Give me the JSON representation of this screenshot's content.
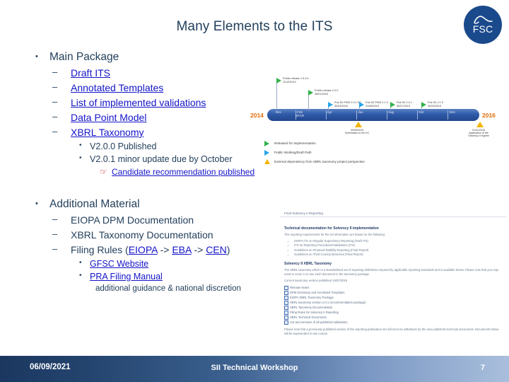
{
  "slide": {
    "title": "Many Elements to the ITS",
    "logo": {
      "text": "FSC",
      "icon": "fsc-mountain-logo",
      "color": "#1B4A8C"
    }
  },
  "content": {
    "main_package": {
      "label": "Main Package",
      "marker": "•",
      "items": [
        {
          "label": "Draft ITS",
          "marker": "–",
          "link": true
        },
        {
          "label": "Annotated Templates",
          "marker": "–",
          "link": true
        },
        {
          "label": "List of implemented validations",
          "marker": "–",
          "link": true
        },
        {
          "label": "Data Point Model",
          "marker": "–",
          "link": true
        },
        {
          "label": "XBRL Taxonomy",
          "marker": "–",
          "link": true
        }
      ],
      "taxonomy_notes": [
        {
          "label": "V2.0.0 Published",
          "marker": "•"
        },
        {
          "label": "V2.0.1 minor update due by October",
          "marker": "•"
        }
      ],
      "candidate_note": {
        "label": "Candidate recommendation published",
        "marker": "☞",
        "marker_color": "#C00000",
        "link": true
      }
    },
    "additional_material": {
      "label": "Additional Material",
      "marker": "•",
      "items": [
        {
          "label": "EIOPA DPM Documentation",
          "marker": "–",
          "link": false
        },
        {
          "label": "XBRL Taxonomy Documentation",
          "marker": "–",
          "link": false
        }
      ],
      "filing_rules": {
        "marker": "–",
        "prefix": "Filing Rules (",
        "link1": "EIOPA",
        "sep1": " -> ",
        "link2": "EBA",
        "sep2": " -> ",
        "link3": "CEN",
        "suffix": ")"
      },
      "sub_links": [
        {
          "label": "GFSC Website",
          "marker": "•",
          "link": true
        },
        {
          "label": "PRA Filing Manual",
          "marker": "•",
          "link": true
        }
      ],
      "note": "additional guidance & national discretion"
    }
  },
  "timeline": {
    "year_start": "2014",
    "year_end": "2016",
    "months": [
      "Dec",
      "Feb\nSFCR",
      "Apr",
      "Jun",
      "Aug",
      "Oct",
      "Dec"
    ],
    "milestones": [
      {
        "type": "green-flag",
        "title": "Public release 1.5.2.b",
        "date": "11/12/2014"
      },
      {
        "type": "green-flag",
        "title": "Public release 2.0.0",
        "date": "28/01/2015"
      },
      {
        "type": "blue-flag",
        "title": "Pub SII PWD 2.0.1 RC",
        "date": "30/04/2015"
      },
      {
        "type": "blue-flag",
        "title": "Pub SII PWD 2.1.0",
        "date": "31/08/2015"
      },
      {
        "type": "green-flag",
        "title": "Pub SII 2.0.1",
        "date": "30/07/2015"
      },
      {
        "type": "green-flag",
        "title": "Pub SII 2.1.0",
        "date": "30/09/2015"
      }
    ],
    "dependencies": [
      {
        "date": "30/06/2015",
        "label": "Submission to the EC"
      },
      {
        "date": "01/01/2016",
        "label": "Application of the\nSolvency II regime"
      }
    ],
    "legend": [
      {
        "glyph": "green-flag",
        "label": "Released for Implementation"
      },
      {
        "glyph": "blue-flag",
        "label": "Public Working/Draft  Path"
      },
      {
        "glyph": "warn-triangle",
        "label": "External dependency from XBRL taxonomy project perspective"
      }
    ]
  },
  "doc_screenshot": {
    "header": "Final Solvency II Reporting",
    "heading1": "Technical documentation for Solvency II implementation",
    "para1": "The reporting requirements for the SII information are based on the following:",
    "bullets": [
      "EIOPA ITS on Regular Supervisory Reporting (Draft ITS)",
      "ITS on Reporting Procedures/Validations (ITS)",
      "Guidelines on Financial Stability Reporting (Final Report)",
      "Guidelines on Third Country Branches (Final Report)"
    ],
    "heading2": "Solvency II XBRL Taxonomy",
    "para2": "The XBRL taxonomy which is a standardised set of reporting definitions required by applicable reporting standards and is available below. Please note that you may need to zoom in to see each document in the taxonomy package.",
    "para3": "Current taxonomy version published 19/07/2015",
    "checks": [
      "Release Notes",
      "DPM Dictionary and Annotated Templates",
      "EIOPA XBRL Taxonomy Package",
      "XBRL taxonomy version 2.0.1 (recommendation package)",
      "XBRL Taxonomy Documentation",
      "Filing Rules for Solvency II Reporting",
      "XBRL Technical Documents",
      "List and versions of all published validations"
    ],
    "footer_para": "Please note that a previously published version of the reporting publication set will soon be withdrawn by the new published technical documents. Documents below will be superseded in due course."
  },
  "footer": {
    "date": "06/09/2021",
    "center": "SII Technical Workshop",
    "page": "7"
  }
}
